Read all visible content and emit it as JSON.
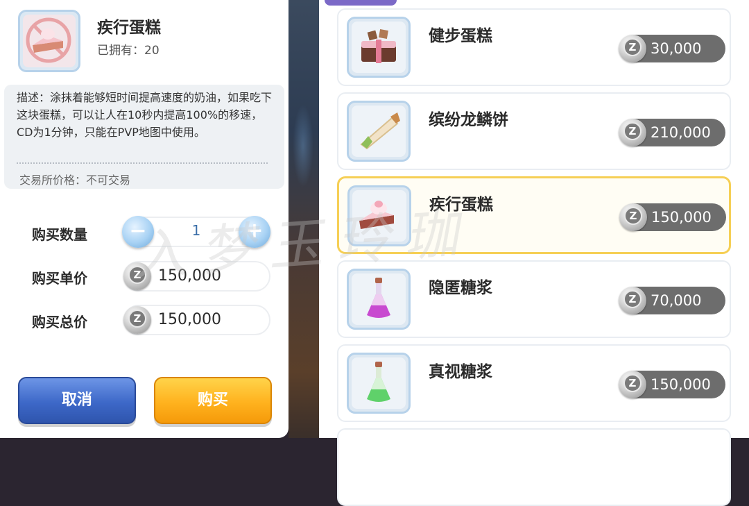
{
  "detail": {
    "item_name": "疾行蛋糕",
    "owned": "已拥有：20",
    "description": "描述：涂抹着能够短时间提高速度的奶油，如果吃下这块蛋糕，可以让人在10秒内提高100%的移速，CD为1分钟，只能在PVP地图中使用。",
    "trade_price": "交易所价格：不可交易",
    "quantity_label": "购买数量",
    "quantity_value": "1",
    "unit_price_label": "购买单价",
    "unit_price_value": "150,000",
    "total_price_label": "购买总价",
    "total_price_value": "150,000",
    "minus_symbol": "−",
    "plus_symbol": "+",
    "cancel_label": "取消",
    "buy_label": "购买"
  },
  "shop": {
    "items": [
      {
        "name": "健步蛋糕",
        "price": "30,000",
        "icon": "chocolate-cake-icon"
      },
      {
        "name": "缤纷龙鳞饼",
        "price": "210,000",
        "icon": "crepe-roll-icon"
      },
      {
        "name": "疾行蛋糕",
        "price": "150,000",
        "icon": "strawberry-cake-icon",
        "selected": true
      },
      {
        "name": "隐匿糖浆",
        "price": "70,000",
        "icon": "purple-potion-icon"
      },
      {
        "name": "真视糖浆",
        "price": "150,000",
        "icon": "green-potion-icon"
      }
    ]
  },
  "watermark": "入梦玉玲珈",
  "colors": {
    "cancel": "#3d68c8",
    "buy": "#ffb21e",
    "selected_border": "#f6cf55",
    "price_pill": "#6d6d6d",
    "icon_frame": "#b7d2ea"
  }
}
